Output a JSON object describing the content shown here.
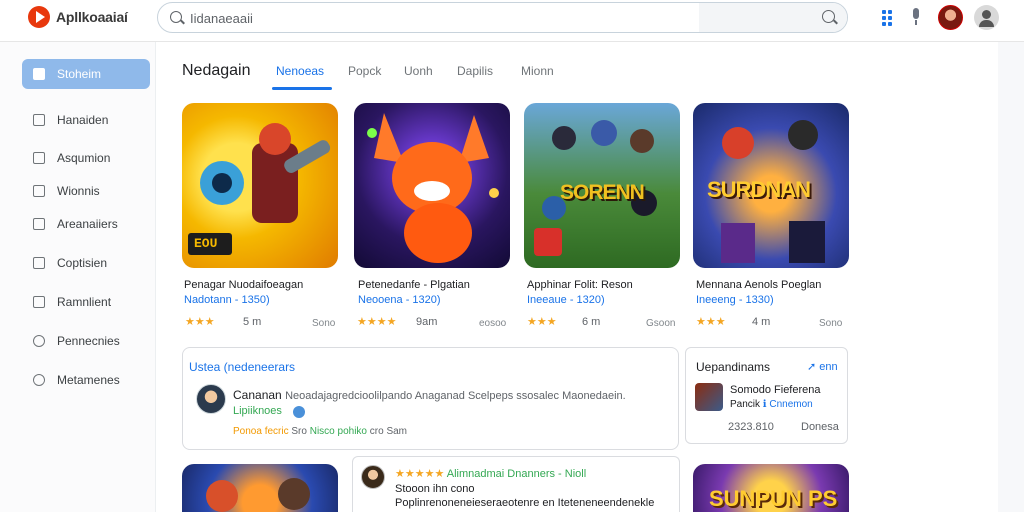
{
  "app": {
    "title": "Apllkoaaiaí"
  },
  "search": {
    "value": "Iidanaeaaii"
  },
  "sidebar": {
    "items": [
      {
        "label": "Stoheim",
        "icon": "home-icon"
      },
      {
        "label": "Hanaiden",
        "icon": "apps-icon"
      },
      {
        "label": "Asqumion",
        "icon": "tag-icon"
      },
      {
        "label": "Wionnis",
        "icon": "people-icon"
      },
      {
        "label": "Areanaiiers",
        "icon": "grid-icon"
      },
      {
        "label": "Coptisien",
        "icon": "folder-icon"
      },
      {
        "label": "Ramnlient",
        "icon": "book-icon"
      },
      {
        "label": "Pennecnies",
        "icon": "chat-icon"
      },
      {
        "label": "Metamenes",
        "icon": "circle-icon"
      }
    ]
  },
  "main": {
    "title": "Nedagain",
    "tabs": [
      "Nenoeas",
      "Popck",
      "Uonh",
      "Dapilis",
      "Mionn"
    ]
  },
  "cards": [
    {
      "title": "Penagar  Nuodaifoeagan",
      "sub": "Nadotann - 1350)",
      "stars": "★★★",
      "size": "5 m",
      "downloads": "Sono",
      "art_text": "EOU",
      "colors": [
        "#f5b800",
        "#d81b60"
      ]
    },
    {
      "title": "Petenedanfe - Plgatian",
      "sub": "Neooena - 1320)",
      "stars": "★★★★",
      "size": "9am",
      "downloads": "eosoo",
      "art_text": "",
      "colors": [
        "#3a1b7a",
        "#ff6a1a"
      ]
    },
    {
      "title": "Apphinar Folit: Reson",
      "sub": "Ineeaue - 1320)",
      "stars": "★★★",
      "size": "6 m",
      "downloads": "Gsoon",
      "art_text": "SORENN",
      "colors": [
        "#4a8a3a",
        "#2b5fa8"
      ]
    },
    {
      "title": "Mennana  Aenols Poeglan",
      "sub": "Ineeeng - 1330)",
      "stars": "★★★",
      "size": "4 m",
      "downloads": "Sono",
      "art_text": "SURDNAN",
      "colors": [
        "#1a3a8a",
        "#e84a1a"
      ]
    }
  ],
  "review": {
    "heading": "Ustea (nedeneerars",
    "name": "Cananan",
    "text": "Neoadajagredcioolilpando Anaganad Scelpeps ssosalec Maonedaein.",
    "tag": "Lipiiknoes",
    "meta_orange": "Ponoa fecric",
    "meta_mid": "Sro",
    "meta_green1": "Nisco",
    "meta_green2": "pohiko",
    "meta_tail1": "cro",
    "meta_tail2": "Sam"
  },
  "side_panel": {
    "heading": "Uepandinams",
    "link": "enn",
    "title": "Somodo Fieferena",
    "sub_left": "Pancik",
    "sub_right": "Cnnemon",
    "count": "2323.810",
    "action": "Donesa"
  },
  "comment": {
    "stars": "★★★★★",
    "author": "Alimnadmai  Dnanners - Nioll",
    "line2": "Stooon  ihn cono",
    "line3": "Poplinrenoneneieseraeotenre en Iteteneneendenekle"
  },
  "bottom_art": {
    "right_text": "SUNPUN PS"
  }
}
